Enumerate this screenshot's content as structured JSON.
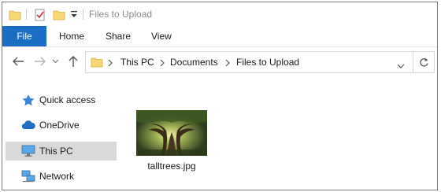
{
  "window": {
    "title": "Files to Upload"
  },
  "ribbon": {
    "tabs": [
      {
        "label": "File"
      },
      {
        "label": "Home"
      },
      {
        "label": "Share"
      },
      {
        "label": "View"
      }
    ]
  },
  "address_bar": {
    "crumbs": [
      "This PC",
      "Documents",
      "Files to Upload"
    ]
  },
  "sidebar": {
    "items": [
      {
        "label": "Quick access",
        "icon": "star-icon"
      },
      {
        "label": "OneDrive",
        "icon": "cloud-icon"
      },
      {
        "label": "This PC",
        "icon": "monitor-icon",
        "selected": true
      },
      {
        "label": "Network",
        "icon": "network-icon"
      }
    ]
  },
  "files": [
    {
      "name": "talltrees.jpg",
      "type": "image"
    }
  ],
  "colors": {
    "accent": "#1a6fc4",
    "folder": "#f8d775",
    "selected_bg": "#d9d9d9"
  }
}
